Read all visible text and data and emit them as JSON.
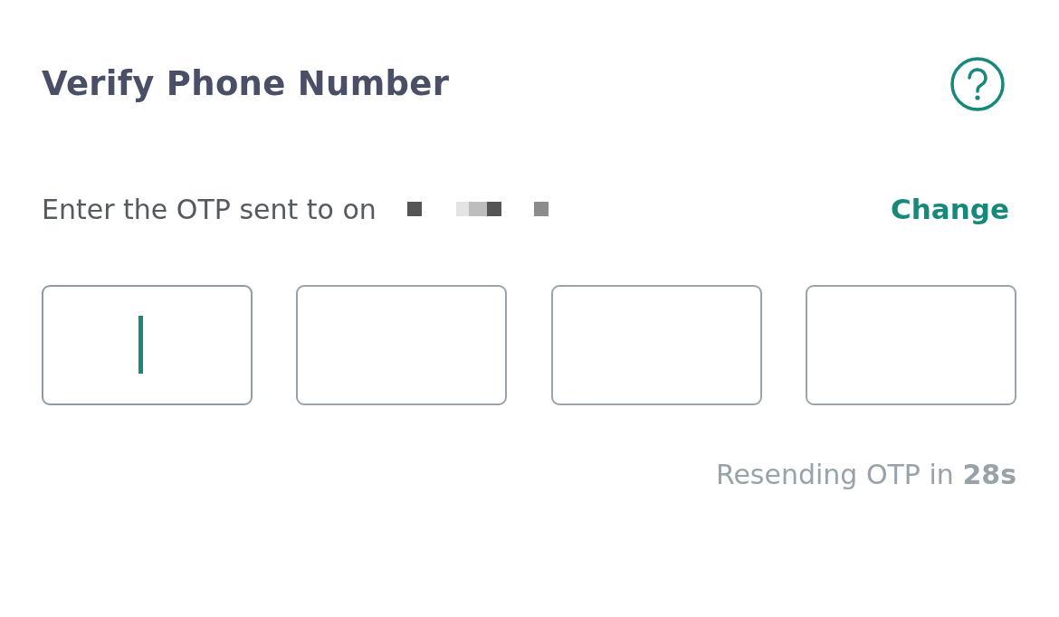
{
  "title": "Verify Phone Number",
  "subtitle": "Enter the OTP sent to on",
  "change_link": "Change",
  "otp_fields": [
    {
      "focused": true
    },
    {
      "focused": false
    },
    {
      "focused": false
    },
    {
      "focused": false
    }
  ],
  "resend": "Resending OTP in **28s**"
}
